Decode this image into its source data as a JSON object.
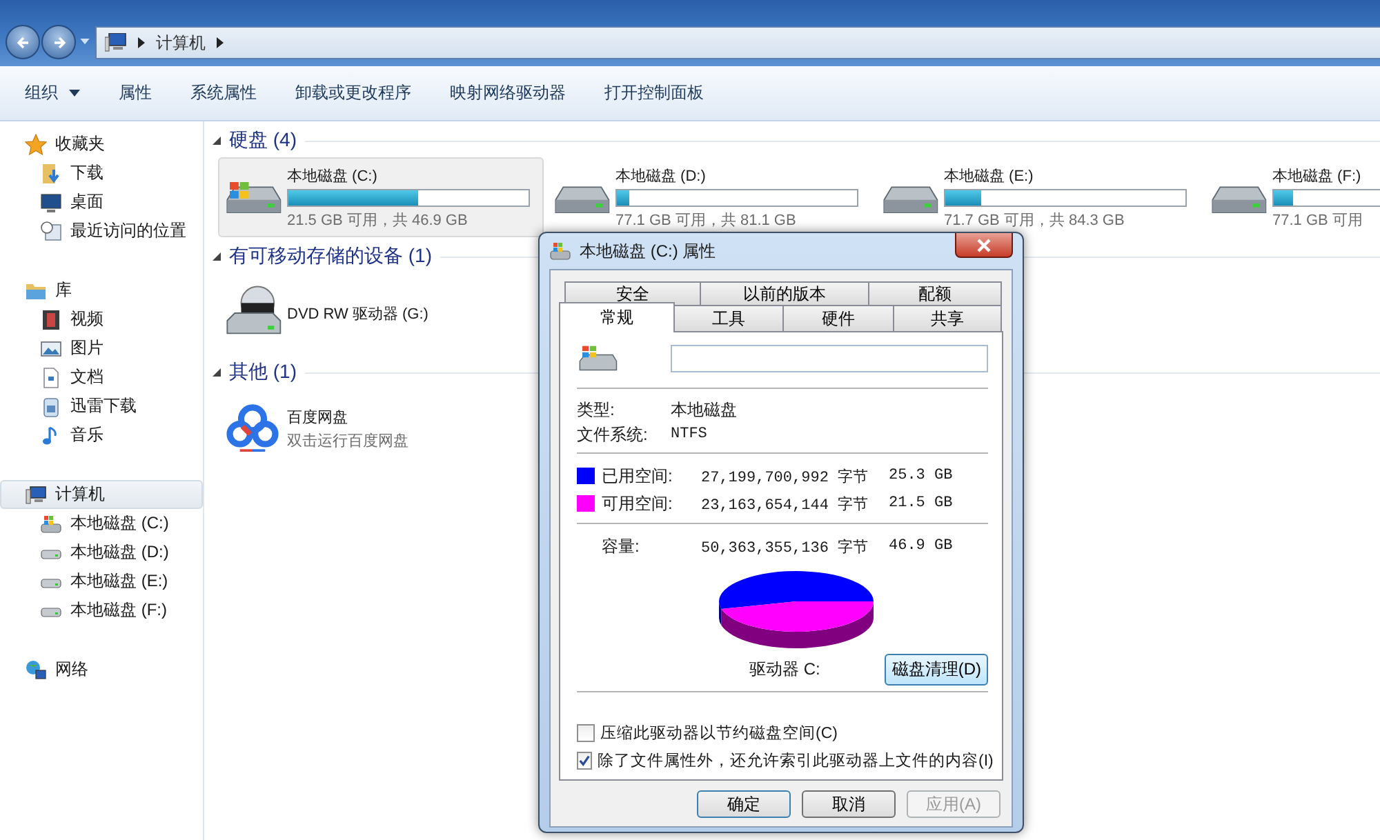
{
  "window": {
    "breadcrumb": [
      "计算机"
    ]
  },
  "toolbar": [
    {
      "label": "组织",
      "menu": true
    },
    {
      "label": "属性",
      "menu": false
    },
    {
      "label": "系统属性",
      "menu": false
    },
    {
      "label": "卸载或更改程序",
      "menu": false
    },
    {
      "label": "映射网络驱动器",
      "menu": false
    },
    {
      "label": "打开控制面板",
      "menu": false
    }
  ],
  "sidebar": {
    "groups": [
      {
        "label": "收藏夹",
        "selected": false,
        "children": [
          {
            "label": "下载",
            "selected": false
          },
          {
            "label": "桌面",
            "selected": false
          },
          {
            "label": "最近访问的位置",
            "selected": false
          }
        ]
      },
      {
        "label": "库",
        "selected": false,
        "children": [
          {
            "label": "视频",
            "selected": false
          },
          {
            "label": "图片",
            "selected": false
          },
          {
            "label": "文档",
            "selected": false
          },
          {
            "label": "迅雷下载",
            "selected": false
          },
          {
            "label": "音乐",
            "selected": false
          }
        ]
      },
      {
        "label": "计算机",
        "selected": true,
        "children": [
          {
            "label": "本地磁盘 (C:)",
            "selected": false
          },
          {
            "label": "本地磁盘 (D:)",
            "selected": false
          },
          {
            "label": "本地磁盘 (E:)",
            "selected": false
          },
          {
            "label": "本地磁盘 (F:)",
            "selected": false
          }
        ]
      },
      {
        "label": "网络",
        "selected": false
      }
    ]
  },
  "content": {
    "sections": [
      {
        "title": "硬盘 (4)",
        "expanded": true,
        "items": [
          {
            "kind": "system_drive",
            "name": "本地磁盘 (C:)",
            "level": 0.54,
            "detail": "21.5 GB 可用，共 46.9 GB",
            "selected": true
          },
          {
            "kind": "drive",
            "name": "本地磁盘 (D:)",
            "level": 0.05,
            "detail": "77.1 GB 可用，共 81.1 GB",
            "selected": false
          },
          {
            "kind": "drive",
            "name": "本地磁盘 (E:)",
            "level": 0.15,
            "detail": "71.7 GB 可用，共 84.3 GB",
            "selected": false
          },
          {
            "kind": "drive",
            "name": "本地磁盘 (F:)",
            "level": 0.08,
            "detail": "77.1 GB 可用",
            "selected": false
          }
        ]
      },
      {
        "title": "有可移动存储的设备 (1)",
        "expanded": true,
        "items": [
          {
            "kind": "dvd",
            "name": "DVD RW 驱动器 (G:)",
            "selected": false
          }
        ]
      },
      {
        "title": "其他 (1)",
        "expanded": true,
        "items": [
          {
            "kind": "app",
            "name": "百度网盘",
            "detail": "双击运行百度网盘",
            "selected": false
          }
        ]
      }
    ]
  },
  "dialog": {
    "title": "本地磁盘 (C:) 属性",
    "tabs_back": [
      {
        "label": "安全",
        "selected": false
      },
      {
        "label": "以前的版本",
        "selected": false
      },
      {
        "label": "配额",
        "selected": false
      }
    ],
    "tabs_front": [
      {
        "label": "常规",
        "selected": true
      },
      {
        "label": "工具",
        "selected": false
      },
      {
        "label": "硬件",
        "selected": false
      },
      {
        "label": "共享",
        "selected": false
      }
    ],
    "info": [
      {
        "label": "类型:",
        "value": "本地磁盘"
      },
      {
        "label": "文件系统:",
        "value": "NTFS"
      }
    ],
    "space": [
      {
        "label": "已用空间:",
        "color": "#0000ff",
        "bytes": "27,199,700,992 字节",
        "size": "25.3 GB"
      },
      {
        "label": "可用空间:",
        "color": "#ff00ff",
        "bytes": "23,163,654,144 字节",
        "size": "21.5 GB"
      }
    ],
    "capacity": {
      "label": "容量:",
      "bytes": "50,363,355,136 字节",
      "size": "46.9 GB"
    },
    "drive_label": "驱动器 C:",
    "cleanup_button": "磁盘清理(D)",
    "options": [
      {
        "label": "压缩此驱动器以节约磁盘空间(C)",
        "checked": false
      },
      {
        "label": "除了文件属性外，还允许索引此驱动器上文件的内容(I)",
        "checked": true
      }
    ],
    "buttons": [
      {
        "label": "确定",
        "default": true,
        "disabled": false
      },
      {
        "label": "取消",
        "default": false,
        "disabled": false
      },
      {
        "label": "应用(A)",
        "default": false,
        "disabled": true
      }
    ]
  }
}
